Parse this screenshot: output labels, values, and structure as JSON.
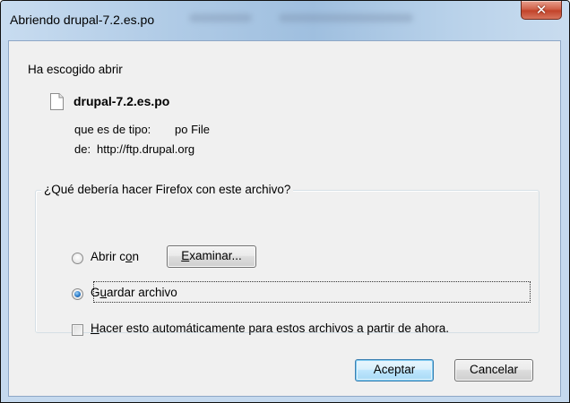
{
  "window": {
    "title": "Abriendo drupal-7.2.es.po",
    "close_symbol": "✕"
  },
  "intro": {
    "heading": "Ha escogido abrir",
    "file_name": "drupal-7.2.es.po",
    "type_label": "que es de tipo:",
    "type_value": "po File",
    "from_label": "de:",
    "from_value": "http://ftp.drupal.org",
    "file_icon": "document-icon"
  },
  "action_group": {
    "label": "¿Qué debería hacer Firefox con este archivo?",
    "open_with": {
      "label_before": "Abrir c",
      "label_accel": "o",
      "label_after": "n",
      "selected": false
    },
    "browse_button": {
      "accel": "E",
      "label_rest": "xaminar..."
    },
    "save_file": {
      "label_before": "G",
      "label_accel": "u",
      "label_after": "ardar archivo",
      "selected": true
    },
    "auto_checkbox": {
      "accel": "H",
      "label_rest": "acer esto automáticamente para estos archivos a partir de ahora.",
      "checked": false
    }
  },
  "buttons": {
    "accept": "Aceptar",
    "cancel": "Cancelar"
  },
  "colors": {
    "title_bar": "#b9d1ea",
    "close_button": "#c2432a",
    "dialog_face": "#f0f0f0",
    "default_button_border": "#3c7fb1"
  }
}
